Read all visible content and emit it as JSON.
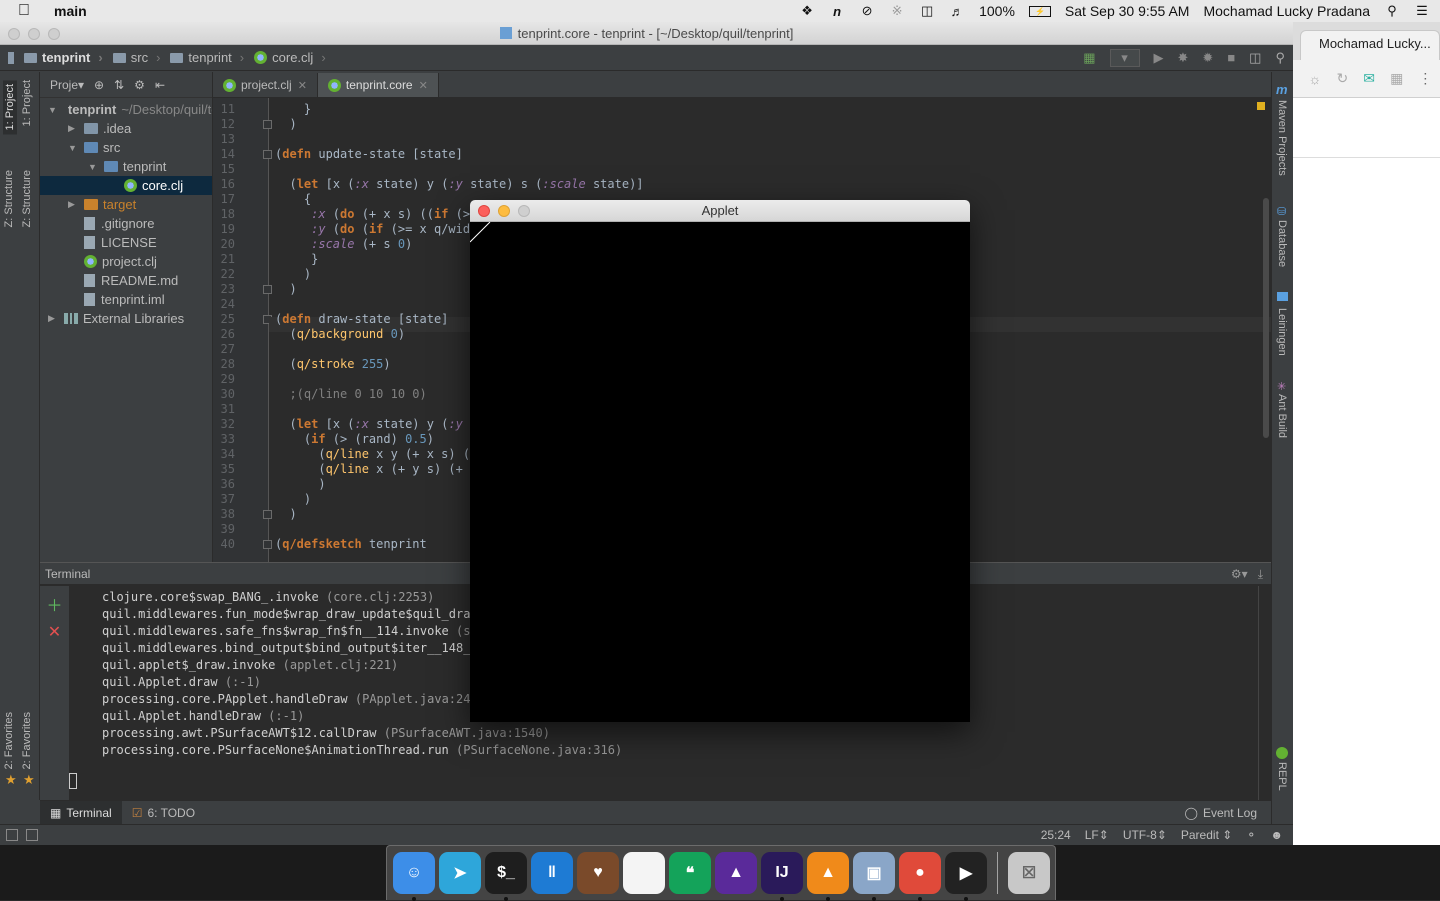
{
  "menubar": {
    "app_name": "main",
    "battery": "100%",
    "datetime": "Sat Sep 30  9:55 AM",
    "user": "Mochamad Lucky Pradana",
    "icons": [
      "apple-icon",
      "dropbox-icon",
      "n-icon",
      "circle-icon",
      "bluetooth-icon",
      "wifi-icon",
      "volume-icon",
      "battery-icon",
      "spotlight-icon",
      "notification-center-icon"
    ]
  },
  "ide": {
    "window_title": "tenprint.core - tenprint - [~/Desktop/quil/tenprint]",
    "breadcrumbs": [
      "tenprint",
      "src",
      "tenprint",
      "core.clj"
    ],
    "project_panel": {
      "view_label": "Proje",
      "tree": [
        {
          "label": "tenprint",
          "suffix": "~/Desktop/quil/tenprint",
          "depth": 0,
          "expanded": true,
          "type": "module"
        },
        {
          "label": ".idea",
          "depth": 1,
          "expanded": false,
          "type": "folder"
        },
        {
          "label": "src",
          "depth": 1,
          "expanded": true,
          "type": "src"
        },
        {
          "label": "tenprint",
          "depth": 2,
          "expanded": true,
          "type": "src"
        },
        {
          "label": "core.clj",
          "depth": 3,
          "type": "clj",
          "selected": true
        },
        {
          "label": "target",
          "depth": 1,
          "expanded": false,
          "type": "target"
        },
        {
          "label": ".gitignore",
          "depth": 1,
          "type": "file"
        },
        {
          "label": "LICENSE",
          "depth": 1,
          "type": "file"
        },
        {
          "label": "project.clj",
          "depth": 1,
          "type": "clj"
        },
        {
          "label": "README.md",
          "depth": 1,
          "type": "file"
        },
        {
          "label": "tenprint.iml",
          "depth": 1,
          "type": "file"
        },
        {
          "label": "External Libraries",
          "depth": 0,
          "expanded": false,
          "type": "lib"
        }
      ]
    },
    "tabs": [
      {
        "label": "project.clj",
        "active": false
      },
      {
        "label": "tenprint.core",
        "active": true
      }
    ],
    "left_tool_labels": [
      "1: Project",
      "1: Project",
      "Z: Structure",
      "Z: Structure",
      "2: Favorites",
      "2: Favorites"
    ],
    "right_tool_labels": [
      "Maven Projects",
      "Database",
      "Leiningen",
      "Ant Build",
      "REPL"
    ],
    "code_lines": [
      {
        "n": "11",
        "text": "    }"
      },
      {
        "n": "12",
        "text": "  )"
      },
      {
        "n": "13",
        "text": ""
      },
      {
        "n": "14",
        "text": "(defn update-state [state]"
      },
      {
        "n": "15",
        "text": ""
      },
      {
        "n": "16",
        "text": "  (let [x (:x state) y (:y state) s (:scale state)]"
      },
      {
        "n": "17",
        "text": "    {"
      },
      {
        "n": "18",
        "text": "     :x (do (+ x s) ((if (>= x q/width) 0 x)))"
      },
      {
        "n": "19",
        "text": "     :y (do (if (>= x q/width) (+ y s) y))"
      },
      {
        "n": "20",
        "text": "     :scale (+ s 0)"
      },
      {
        "n": "21",
        "text": "     }"
      },
      {
        "n": "22",
        "text": "    )"
      },
      {
        "n": "23",
        "text": "  )"
      },
      {
        "n": "24",
        "text": ""
      },
      {
        "n": "25",
        "text": "(defn draw-state [state]"
      },
      {
        "n": "26",
        "text": "  (q/background 0)"
      },
      {
        "n": "27",
        "text": ""
      },
      {
        "n": "28",
        "text": "  (q/stroke 255)"
      },
      {
        "n": "29",
        "text": ""
      },
      {
        "n": "30",
        "text": "  ;(q/line 0 10 10 0)"
      },
      {
        "n": "31",
        "text": ""
      },
      {
        "n": "32",
        "text": "  (let [x (:x state) y (:y state) s (:scale state)]"
      },
      {
        "n": "33",
        "text": "    (if (> (rand) 0.5)"
      },
      {
        "n": "34",
        "text": "      (q/line x y (+ x s) (+ y s))"
      },
      {
        "n": "35",
        "text": "      (q/line x (+ y s) (+ x s) y)"
      },
      {
        "n": "36",
        "text": "      )"
      },
      {
        "n": "37",
        "text": "    )"
      },
      {
        "n": "38",
        "text": "  )"
      },
      {
        "n": "39",
        "text": ""
      },
      {
        "n": "40",
        "text": "(q/defsketch tenprint"
      }
    ],
    "terminal": {
      "title": "Terminal",
      "lines": [
        {
          "main": "clojure.core$swap_BANG_.invoke ",
          "dim": "(core.clj:2253)"
        },
        {
          "main": "quil.middlewares.fun_mode$wrap_draw_update$quil_draw_",
          "dim": ""
        },
        {
          "main": "quil.middlewares.safe_fns$wrap_fn$fn__114.invoke ",
          "dim": "(sa"
        },
        {
          "main": "quil.middlewares.bind_output$bind_output$iter__148__1",
          "dim": ""
        },
        {
          "main": "quil.applet$_draw.invoke ",
          "dim": "(applet.clj:221)"
        },
        {
          "main": "quil.Applet.draw ",
          "dim": "(:-1)"
        },
        {
          "main": "processing.core.PApplet.handleDraw ",
          "dim": "(PApplet.java:2418"
        },
        {
          "main": "quil.Applet.handleDraw ",
          "dim": "(:-1)"
        },
        {
          "main": "processing.awt.PSurfaceAWT$12.callDraw ",
          "dim": "(PSurfaceAWT.java:1540)"
        },
        {
          "main": "processing.core.PSurfaceNone$AnimationThread.run ",
          "dim": "(PSurfaceNone.java:316)"
        }
      ]
    },
    "bottom_tabs": [
      "Terminal",
      "6: TODO"
    ],
    "event_log": "Event Log",
    "status": {
      "position": "25:24",
      "line_sep": "LF",
      "encoding": "UTF-8",
      "mode": "Paredit"
    }
  },
  "applet": {
    "title": "Applet"
  },
  "chrome": {
    "tab_title": "Mochamad Lucky..."
  },
  "dock": {
    "apps": [
      "Finder",
      "Telegram",
      "Terminal",
      "Trello",
      "Cake",
      "Document",
      "Hangouts",
      "Affinity",
      "IntelliJ IDEA",
      "VLC",
      "Preview",
      "Chrome",
      "QuickTime",
      "Trash"
    ]
  }
}
